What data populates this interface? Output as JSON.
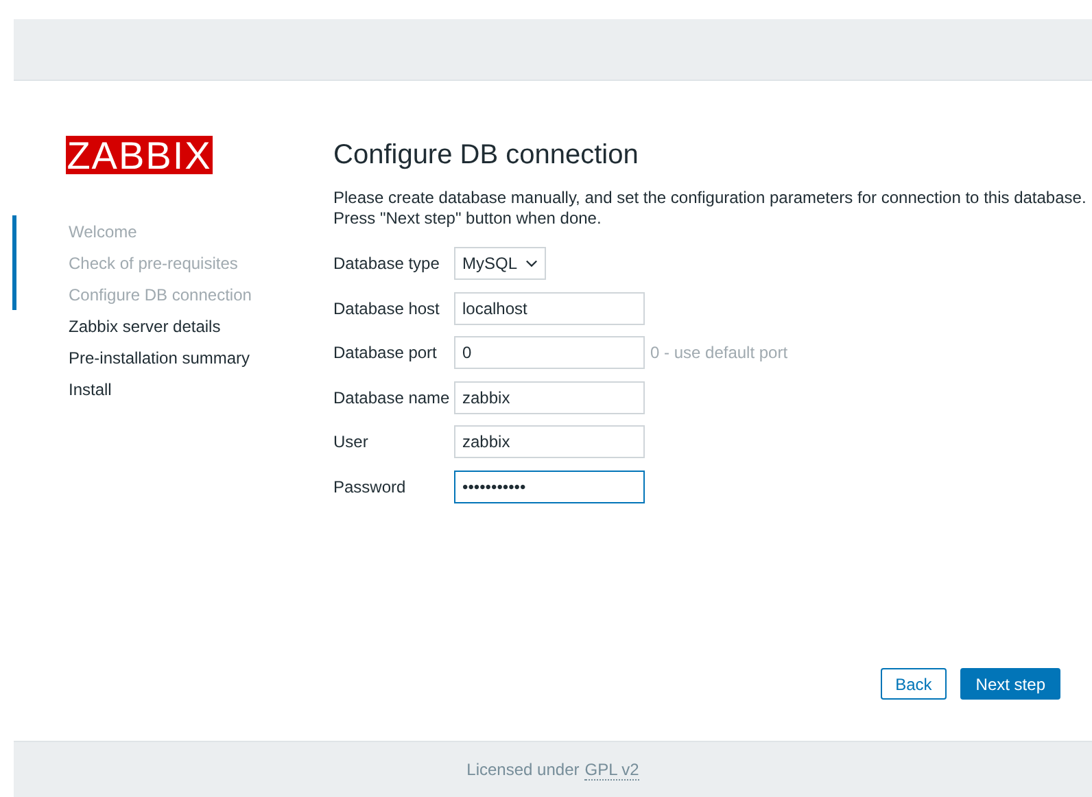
{
  "logo": {
    "text": "ZABBIX"
  },
  "steps": [
    {
      "label": "Welcome",
      "done": true
    },
    {
      "label": "Check of pre-requisites",
      "done": true
    },
    {
      "label": "Configure DB connection",
      "done": true
    },
    {
      "label": "Zabbix server details",
      "done": false
    },
    {
      "label": "Pre-installation summary",
      "done": false
    },
    {
      "label": "Install",
      "done": false
    }
  ],
  "title": "Configure DB connection",
  "description": [
    "Please create database manually, and set the configuration parameters for connection to this database.",
    "Press \"Next step\" button when done."
  ],
  "fields": [
    {
      "kind": "select",
      "label": "Database type",
      "value": "MySQL",
      "focused": false
    },
    {
      "kind": "input",
      "label": "Database host",
      "value": "localhost",
      "focused": false
    },
    {
      "kind": "input",
      "label": "Database port",
      "value": "0",
      "hint": "0 - use default port",
      "focused": false
    },
    {
      "kind": "input",
      "label": "Database name",
      "value": "zabbix",
      "focused": false
    },
    {
      "kind": "input",
      "label": "User",
      "value": "zabbix",
      "focused": false
    },
    {
      "kind": "input",
      "label": "Password",
      "value": "•••••••••••",
      "focused": true
    }
  ],
  "buttons": [
    {
      "label": "Back",
      "kind": "secondary"
    },
    {
      "label": "Next step",
      "kind": "primary"
    }
  ],
  "footer": {
    "text": "Licensed under",
    "link": "GPL v2"
  }
}
